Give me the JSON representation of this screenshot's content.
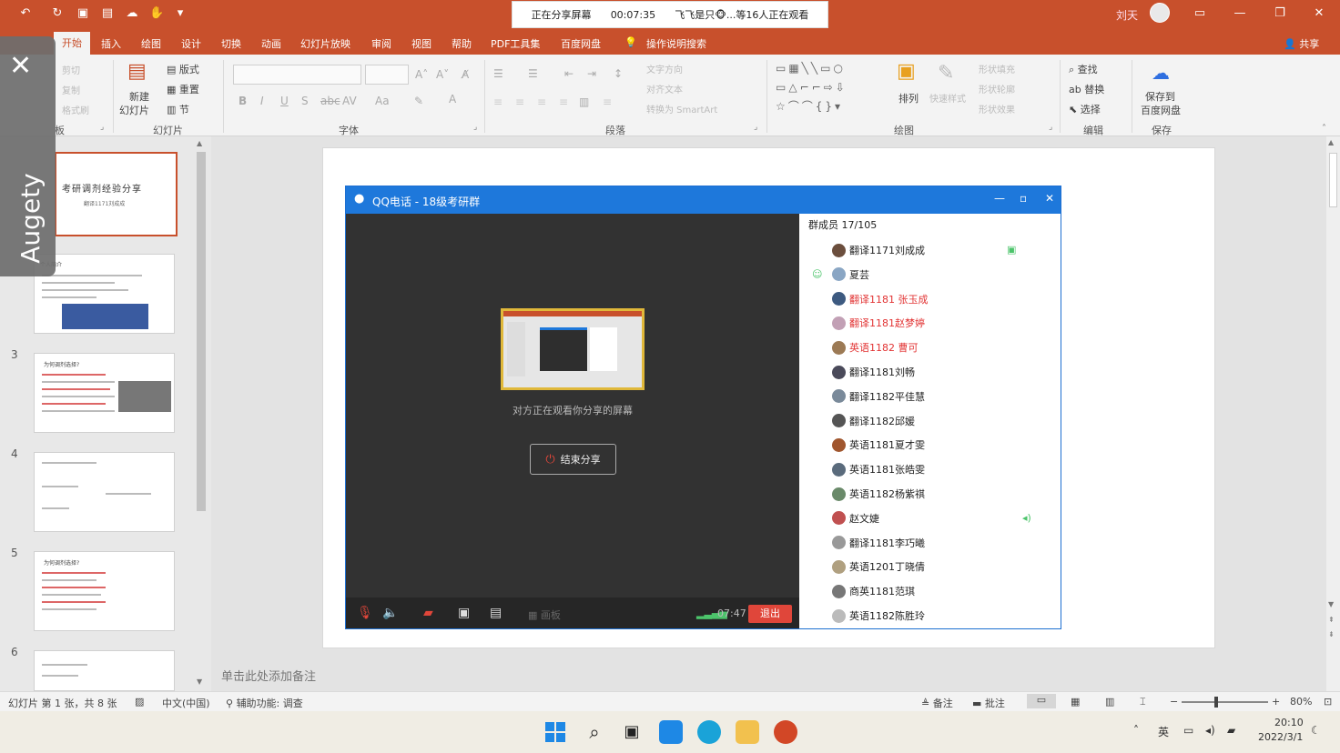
{
  "titlebar": {
    "share_banner": {
      "status": "正在分享屏幕",
      "timer": "00:07:35",
      "viewers": "飞飞是只🐵...等16人正在观看"
    },
    "user": "刘天",
    "quick_access": [
      "undo-icon",
      "redo-icon",
      "save-icon",
      "cloud-icon",
      "touch-icon",
      "more-icon"
    ]
  },
  "tabs": [
    {
      "label": "开始",
      "active": true
    },
    {
      "label": "插入"
    },
    {
      "label": "绘图"
    },
    {
      "label": "设计"
    },
    {
      "label": "切换"
    },
    {
      "label": "动画"
    },
    {
      "label": "幻灯片放映"
    },
    {
      "label": "审阅"
    },
    {
      "label": "视图"
    },
    {
      "label": "帮助"
    },
    {
      "label": "PDF工具集"
    },
    {
      "label": "百度网盘"
    },
    {
      "label": "操作说明搜索"
    }
  ],
  "share_label": "共享",
  "ribbon": {
    "clipboard": {
      "paste": "剪切",
      "copy": "复制",
      "format": "格式刷",
      "group": "板"
    },
    "slides": {
      "new_slide": "新建",
      "new_slide2": "幻灯片",
      "layout": "版式",
      "reset": "重置",
      "section": "节",
      "group": "幻灯片"
    },
    "font": {
      "group": "字体"
    },
    "paragraph": {
      "direction": "文字方向",
      "align": "对齐文本",
      "smartart": "转换为 SmartArt",
      "group": "段落"
    },
    "drawing": {
      "arrange": "排列",
      "quick_styles": "快速样式",
      "fill": "形状填充",
      "outline": "形状轮廓",
      "effects": "形状效果",
      "group": "绘图"
    },
    "editing": {
      "find": "查找",
      "replace": "替换",
      "select": "选择",
      "group": "编辑"
    },
    "save": {
      "label1": "保存到",
      "label2": "百度网盘",
      "group": "保存"
    }
  },
  "overlay": {
    "brand": "Augety"
  },
  "thumbnails": [
    {
      "num": "",
      "title": "考研调剂经验分享",
      "subtitle": "翻译1171刘成成"
    },
    {
      "num": "",
      "title": "个人简介"
    },
    {
      "num": "3",
      "title": "为何调剂选择?"
    },
    {
      "num": "4",
      "title": ""
    },
    {
      "num": "5",
      "title": "为何调剂选择?"
    },
    {
      "num": "6",
      "title": ""
    }
  ],
  "notes_placeholder": "单击此处添加备注",
  "qq": {
    "title": "QQ电话 - 18级考研群",
    "member_header": "群成员 17/105",
    "share_caption": "对方正在观看你分享的屏幕",
    "end_share": "结束分享",
    "toolbar_label": "画板",
    "call_time": "07:47",
    "exit": "退出",
    "members": [
      {
        "name": "翻译1171刘成成",
        "red": false
      },
      {
        "name": "夏芸",
        "red": false
      },
      {
        "name": "翻译1181 张玉成",
        "red": true
      },
      {
        "name": "翻译1181赵梦婷",
        "red": true
      },
      {
        "name": "英语1182 曹可",
        "red": true
      },
      {
        "name": "翻译1181刘畅",
        "red": false
      },
      {
        "name": "翻译1182平佳慧",
        "red": false
      },
      {
        "name": "翻译1182邱媛",
        "red": false
      },
      {
        "name": "英语1181夏才雯",
        "red": false
      },
      {
        "name": "英语1181张皓雯",
        "red": false
      },
      {
        "name": "英语1182杨紫祺",
        "red": false
      },
      {
        "name": "赵文婕",
        "red": false
      },
      {
        "name": "翻译1181李巧曦",
        "red": false
      },
      {
        "name": "英语1201丁晓倩",
        "red": false
      },
      {
        "name": "商英1181范琪",
        "red": false
      },
      {
        "name": "英语1182陈胜玲",
        "red": false
      }
    ]
  },
  "statusbar": {
    "slide_info": "幻灯片 第 1 张，共 8 张",
    "language": "中文(中国)",
    "accessibility": "辅助功能: 调查",
    "notes": "备注",
    "comments": "批注",
    "zoom": "80%"
  },
  "taskbar": {
    "ime": "英",
    "time": "20:10",
    "date": "2022/3/1"
  }
}
